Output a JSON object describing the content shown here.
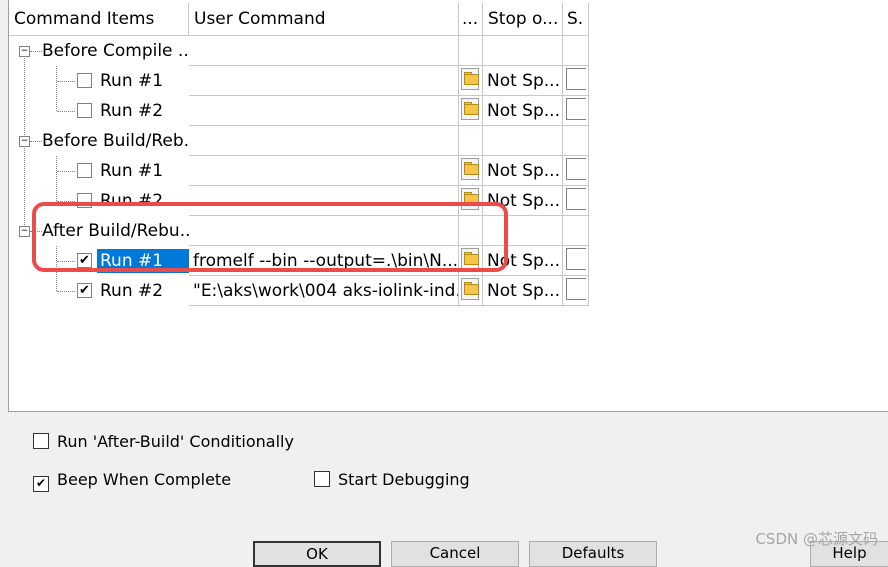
{
  "columns": {
    "items": "Command Items",
    "command": "User Command",
    "dots": "...",
    "stop": "Stop o...",
    "s": "S."
  },
  "groups": [
    {
      "label": "Before Compile ...",
      "runs": [
        {
          "label": "Run #1",
          "checked": false,
          "command": "",
          "stop": "Not Sp..."
        },
        {
          "label": "Run #2",
          "checked": false,
          "command": "",
          "stop": "Not Sp..."
        }
      ]
    },
    {
      "label": "Before Build/Reb...",
      "runs": [
        {
          "label": "Run #1",
          "checked": false,
          "command": "",
          "stop": "Not Sp..."
        },
        {
          "label": "Run #2",
          "checked": false,
          "command": "",
          "stop": "Not Sp..."
        }
      ]
    },
    {
      "label": "After Build/Rebu...",
      "runs": [
        {
          "label": "Run #1",
          "checked": true,
          "selected": true,
          "command": "fromelf --bin --output=.\\bin\\N...",
          "stop": "Not Sp..."
        },
        {
          "label": "Run #2",
          "checked": true,
          "command": "\"E:\\aks\\work\\004 aks-iolink-ind...",
          "stop": "Not Sp..."
        }
      ]
    }
  ],
  "options": {
    "run_after_build": {
      "label": "Run 'After-Build' Conditionally",
      "checked": false
    },
    "beep": {
      "label": "Beep When Complete",
      "checked": true
    },
    "start_debugging": {
      "label": "Start Debugging",
      "checked": false
    }
  },
  "buttons": {
    "ok": "OK",
    "cancel": "Cancel",
    "defaults": "Defaults",
    "help": "Help"
  },
  "watermark": "CSDN @芯源文码",
  "colors": {
    "selection": "#0078d7",
    "highlight": "#ea4c4c"
  }
}
